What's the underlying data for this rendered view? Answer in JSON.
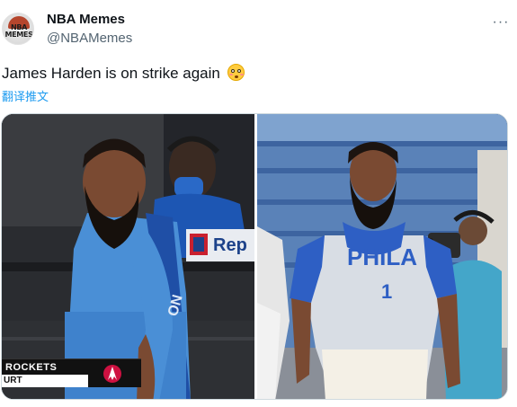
{
  "tweet": {
    "display_name": "NBA Memes",
    "handle": "@NBAMemes",
    "avatar_text_line1": "NBA",
    "avatar_text_line2": "MEMES",
    "text": "James Harden is on strike again",
    "emoji": "flushed-face-emoji",
    "translate_label": "翻译推文",
    "more_label": "···"
  },
  "media": {
    "left_image": {
      "scorebug_team": "ROCKETS",
      "scorebug_court": "URT",
      "background_sign": "Rep"
    },
    "right_image": {
      "jersey_text": "PHILA",
      "jersey_number": "1"
    }
  },
  "colors": {
    "link": "#1d9bf0",
    "text": "#0f1419",
    "secondary": "#536471",
    "rockets_jersey": "#4a8fd6",
    "sixers_blue": "#2e5fc4"
  }
}
